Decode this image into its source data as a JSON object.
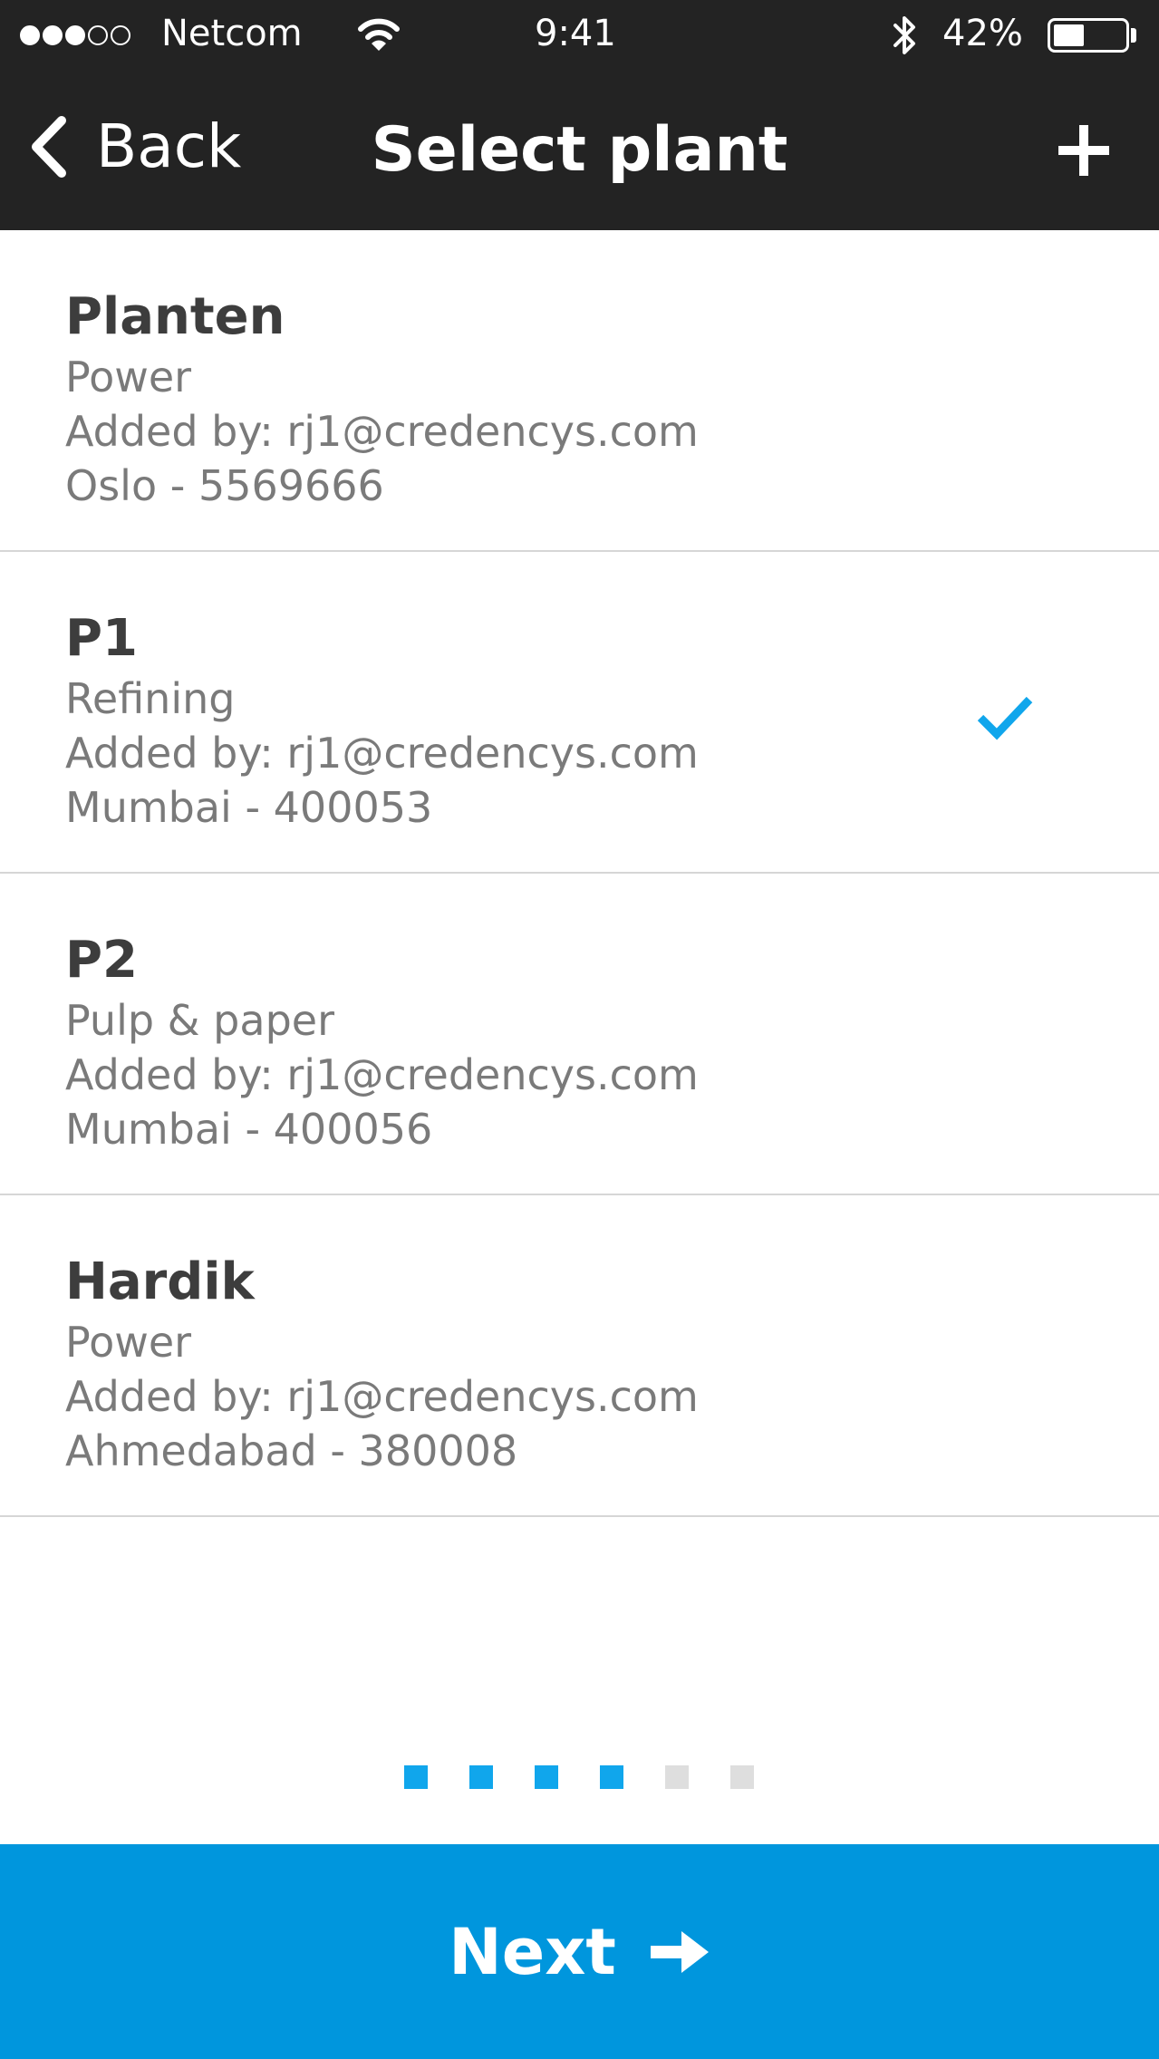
{
  "status_bar": {
    "signal_filled": 3,
    "signal_total": 5,
    "carrier": "Netcom",
    "time": "9:41",
    "battery_pct": "42%",
    "battery_level": 0.42,
    "icons": [
      "wifi-icon",
      "bluetooth-icon",
      "battery-icon"
    ]
  },
  "nav": {
    "back_label": "Back",
    "title": "Select plant",
    "back_icon": "chevron-left-icon",
    "add_icon": "plus-icon"
  },
  "plants": [
    {
      "name": "Planten",
      "industry": "Power",
      "added_by": "Added by: rj1@credencys.com",
      "location": "Oslo - 5569666",
      "selected": false
    },
    {
      "name": "P1",
      "industry": "Refining",
      "added_by": "Added by: rj1@credencys.com",
      "location": "Mumbai - 400053",
      "selected": true
    },
    {
      "name": "P2",
      "industry": "Pulp & paper",
      "added_by": "Added by: rj1@credencys.com",
      "location": "Mumbai - 400056",
      "selected": false
    },
    {
      "name": "Hardik",
      "industry": "Power",
      "added_by": "Added by: rj1@credencys.com",
      "location": "Ahmedabad - 380008",
      "selected": false
    }
  ],
  "pager": {
    "total": 6,
    "completed": 4
  },
  "next_button": {
    "label": "Next",
    "icon": "arrow-right-icon"
  },
  "colors": {
    "bar_background": "#232323",
    "accent": "#0096dd",
    "check": "#10a6ec",
    "pager_active": "#10a6ec",
    "pager_inactive": "#dedede",
    "name_text": "#3d3d3d",
    "detail_text": "#7a7a7a",
    "divider": "#d6d6d6"
  }
}
